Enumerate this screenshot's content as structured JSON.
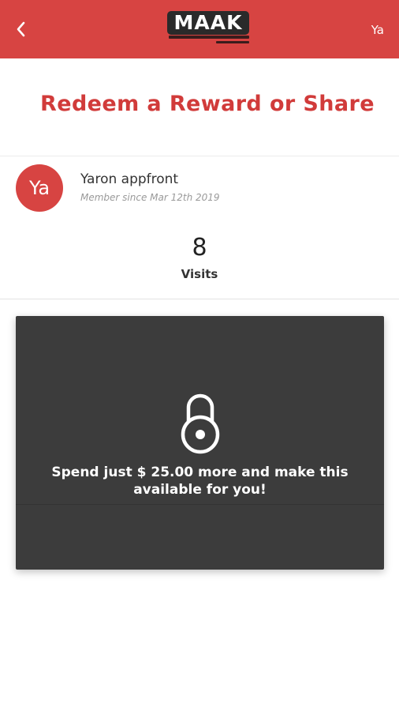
{
  "header": {
    "back_icon": "chevron-left-icon",
    "logo_text": "MAAK",
    "user_initials": "Ya",
    "background_color": "#d74442"
  },
  "page": {
    "title": "Redeem a Reward or Share",
    "title_color": "#d13b3a"
  },
  "member": {
    "avatar_initials": "Ya",
    "name": "Yaron appfront",
    "since": "Member since Mar 12th 2019"
  },
  "stats": {
    "visits_count": "8",
    "visits_label": "Visits"
  },
  "reward_card": {
    "icon": "lock-icon",
    "message": "Spend just $ 25.00 more and make this available for you!",
    "background_color": "#3c3c3c"
  }
}
